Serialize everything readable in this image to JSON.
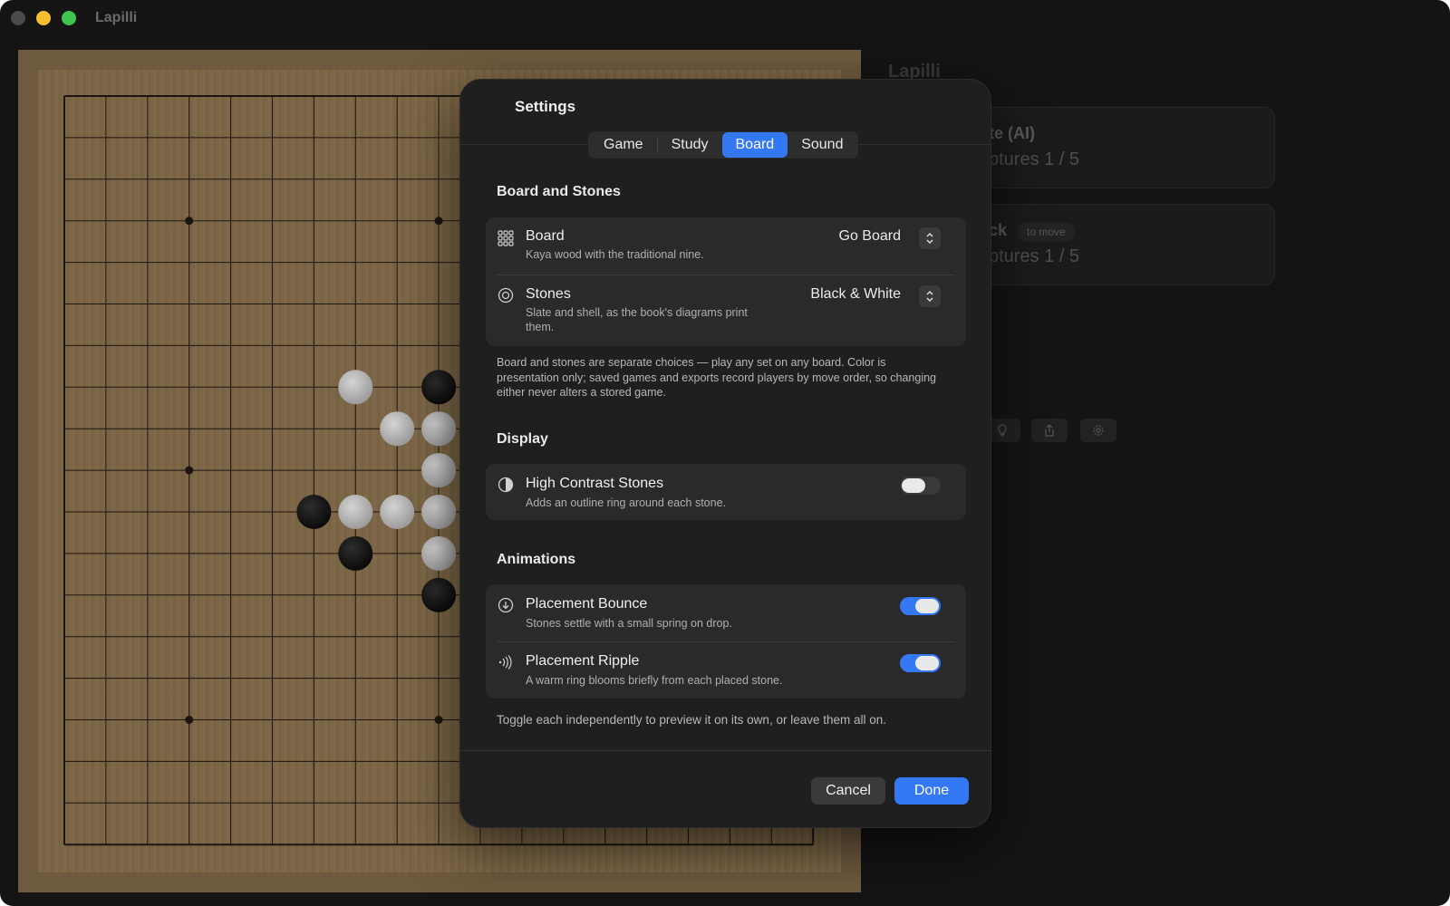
{
  "window": {
    "title": "Lapilli"
  },
  "sidebar": {
    "title": "Lapilli",
    "players": [
      {
        "name": "te (AI)",
        "captures": "ptures 1 / 5",
        "badge": ""
      },
      {
        "name": "ck",
        "captures": "ptures 1 / 5",
        "badge": "to move"
      }
    ],
    "buttons": [
      "lightbulb-icon",
      "share-icon",
      "gear-icon"
    ]
  },
  "board": {
    "size": 19,
    "stones": [
      {
        "col": 7,
        "row": 7,
        "color": "white"
      },
      {
        "col": 9,
        "row": 7,
        "color": "black"
      },
      {
        "col": 8,
        "row": 8,
        "color": "white"
      },
      {
        "col": 9,
        "row": 8,
        "color": "white"
      },
      {
        "col": 9,
        "row": 9,
        "color": "white"
      },
      {
        "col": 6,
        "row": 10,
        "color": "black"
      },
      {
        "col": 7,
        "row": 10,
        "color": "white"
      },
      {
        "col": 8,
        "row": 10,
        "color": "white"
      },
      {
        "col": 9,
        "row": 10,
        "color": "white"
      },
      {
        "col": 7,
        "row": 11,
        "color": "black"
      },
      {
        "col": 9,
        "row": 11,
        "color": "white"
      },
      {
        "col": 9,
        "row": 12,
        "color": "black"
      }
    ]
  },
  "settings": {
    "title": "Settings",
    "tabs": [
      {
        "label": "Game",
        "active": false
      },
      {
        "label": "Study",
        "active": false
      },
      {
        "label": "Board",
        "active": true
      },
      {
        "label": "Sound",
        "active": false
      }
    ],
    "board_and_stones": {
      "heading": "Board and Stones",
      "board": {
        "title": "Board",
        "subtitle": "Kaya wood with the traditional nine.",
        "value": "Go Board"
      },
      "stones": {
        "title": "Stones",
        "subtitle": "Slate and shell, as the book's diagrams print them.",
        "value": "Black & White"
      },
      "note": "Board and stones are separate choices — play any set on any board. Color is presentation only; saved games and exports record players by move order, so changing either never alters a stored game."
    },
    "display": {
      "heading": "Display",
      "high_contrast": {
        "title": "High Contrast Stones",
        "subtitle": "Adds an outline ring around each stone.",
        "on": false
      }
    },
    "animations": {
      "heading": "Animations",
      "bounce": {
        "title": "Placement Bounce",
        "subtitle": "Stones settle with a small spring on drop.",
        "on": true
      },
      "ripple": {
        "title": "Placement Ripple",
        "subtitle": "A warm ring blooms briefly from each placed stone.",
        "on": true
      },
      "note": "Toggle each independently to preview it on its own, or leave them all on."
    },
    "cancel_label": "Cancel",
    "done_label": "Done"
  },
  "colors": {
    "accent": "#3478f6",
    "board_wood": "#7a6445"
  }
}
